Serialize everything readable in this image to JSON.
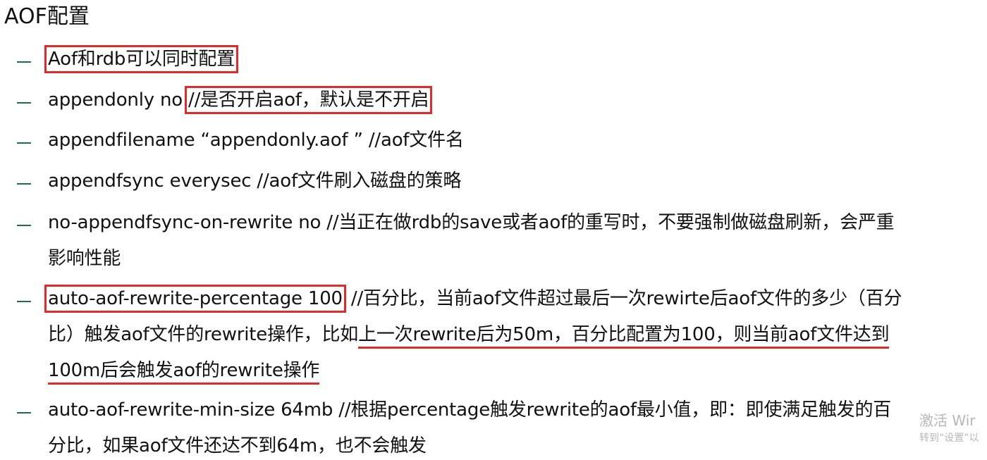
{
  "title": "AOF配置",
  "items": [
    {
      "lines": [
        {
          "parts": [
            "Aof和rdb可以同时配置"
          ]
        }
      ]
    },
    {
      "lines": [
        {
          "parts": [
            "appendonly no ",
            "//是否开启aof，默认是不开启"
          ]
        }
      ]
    },
    {
      "lines": [
        {
          "parts": [
            "appendfilename  “appendonly.aof ” //aof文件名"
          ]
        }
      ]
    },
    {
      "lines": [
        {
          "parts": [
            "appendfsync everysec //aof文件刷入磁盘的策略"
          ]
        }
      ]
    },
    {
      "lines": [
        {
          "parts": [
            "no-appendfsync-on-rewrite no //当正在做rdb的save或者aof的重写时，不要强制做磁盘刷新，会严重"
          ]
        },
        {
          "parts": [
            "影响性能"
          ]
        }
      ]
    },
    {
      "lines": [
        {
          "parts": [
            "auto-aof-rewrite-percentage 100",
            "//百分比，当前aof文件超过最后一次rewirte后aof文件的多少（百分"
          ]
        },
        {
          "parts": [
            "比）触发aof文件的rewrite操作，比如",
            "上一次rewrite后为50m，百分比配置为100，则当前aof文件达到"
          ]
        },
        {
          "parts": [
            "100m后会触发aof的rewrite操作"
          ]
        }
      ]
    },
    {
      "lines": [
        {
          "parts": [
            "auto-aof-rewrite-min-size 64mb  //根据percentage触发rewrite的aof最小值，即：即使满足触发的百"
          ]
        },
        {
          "parts": [
            "分比，如果aof文件还达不到64m，也不会触发"
          ]
        }
      ]
    }
  ],
  "watermark": {
    "line1": "激活 Wir",
    "line2": "转到“设置”以"
  }
}
